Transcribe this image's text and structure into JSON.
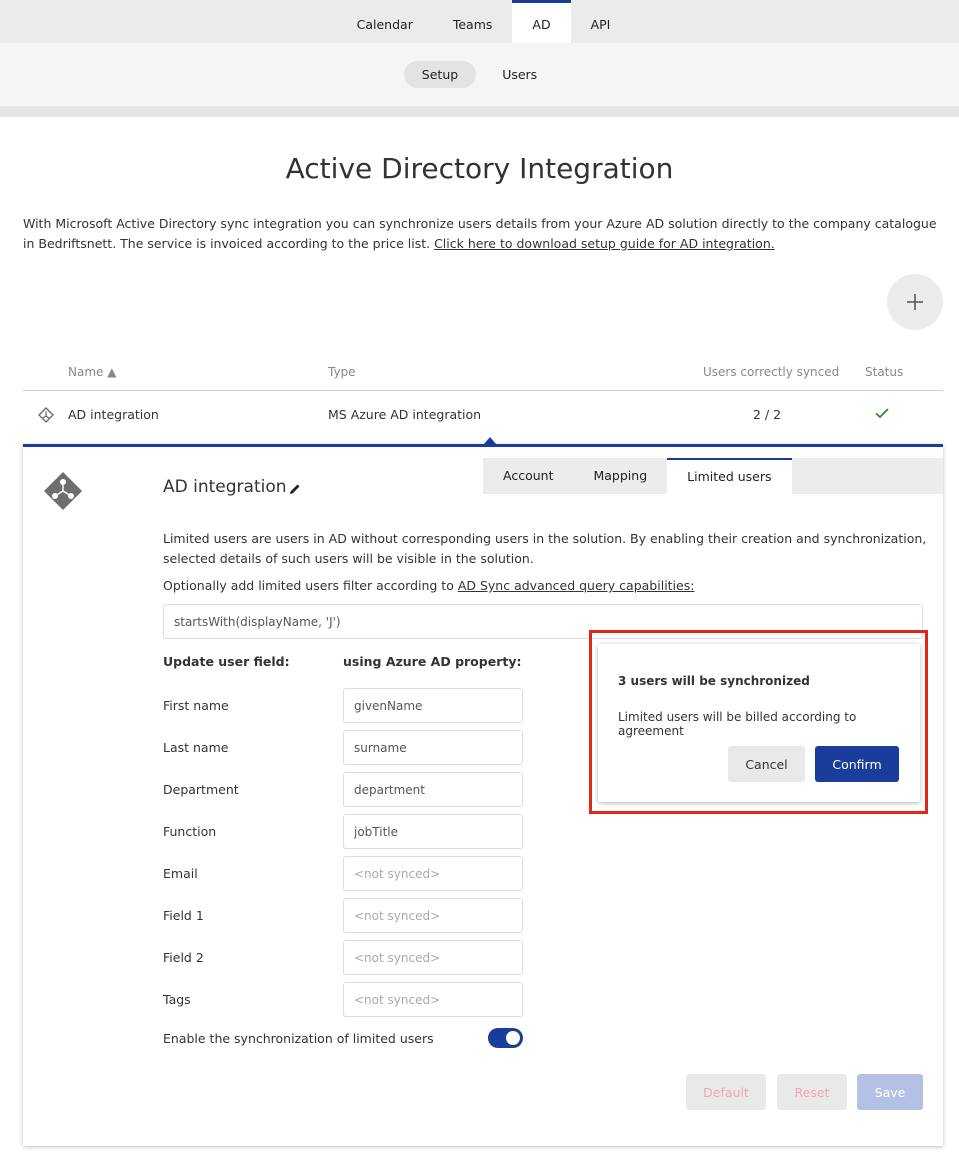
{
  "topnav": {
    "tabs": [
      {
        "label": "Calendar"
      },
      {
        "label": "Teams"
      },
      {
        "label": "AD"
      },
      {
        "label": "API"
      }
    ],
    "active": "AD"
  },
  "subnav": {
    "items": [
      {
        "label": "Setup"
      },
      {
        "label": "Users"
      }
    ],
    "active": "Setup"
  },
  "page": {
    "title": "Active Directory Integration",
    "intro": "With Microsoft Active Directory sync integration you can synchronize users details from your Azure AD solution directly to the company catalogue in Bedriftsnett. The service is invoiced according to the price list. ",
    "intro_link": "Click here to download setup guide for AD integration."
  },
  "table": {
    "headers": {
      "name": "Name ▲",
      "type": "Type",
      "synced": "Users correctly synced",
      "status": "Status"
    },
    "rows": [
      {
        "name": "AD integration",
        "type": "MS Azure AD integration",
        "synced": "2 / 2",
        "status": "ok"
      }
    ]
  },
  "panel": {
    "title": "AD integration",
    "tabs": [
      {
        "label": "Account"
      },
      {
        "label": "Mapping"
      },
      {
        "label": "Limited users"
      }
    ],
    "active_tab": "Limited users",
    "description": "Limited users are users in AD without corresponding users in the solution. By enabling their creation and synchronization, selected details of such users will be visible in the solution.",
    "filter_hint": "Optionally add limited users filter according to ",
    "filter_link": "AD Sync advanced query capabilities:",
    "filter_value": "startsWith(displayName, 'J')",
    "col_field": "Update user field:",
    "col_property": "using Azure AD property:",
    "fields": [
      {
        "label": "First name",
        "value": "givenName",
        "placeholder": ""
      },
      {
        "label": "Last name",
        "value": "surname",
        "placeholder": ""
      },
      {
        "label": "Department",
        "value": "department",
        "placeholder": ""
      },
      {
        "label": "Function",
        "value": "jobTitle",
        "placeholder": ""
      },
      {
        "label": "Email",
        "value": "",
        "placeholder": "<not synced>"
      },
      {
        "label": "Field 1",
        "value": "",
        "placeholder": "<not synced>"
      },
      {
        "label": "Field 2",
        "value": "",
        "placeholder": "<not synced>"
      },
      {
        "label": "Tags",
        "value": "",
        "placeholder": "<not synced>"
      }
    ],
    "toggle_label": "Enable the synchronization of limited users",
    "toggle_on": true,
    "buttons": {
      "default": "Default",
      "reset": "Reset",
      "save": "Save"
    }
  },
  "dialog": {
    "title": "3 users will be synchronized",
    "message": "Limited users will be billed according to agreement",
    "cancel": "Cancel",
    "confirm": "Confirm"
  },
  "colors": {
    "accent": "#1a3d9c",
    "highlight": "#e02614",
    "success": "#2e8b2e"
  }
}
